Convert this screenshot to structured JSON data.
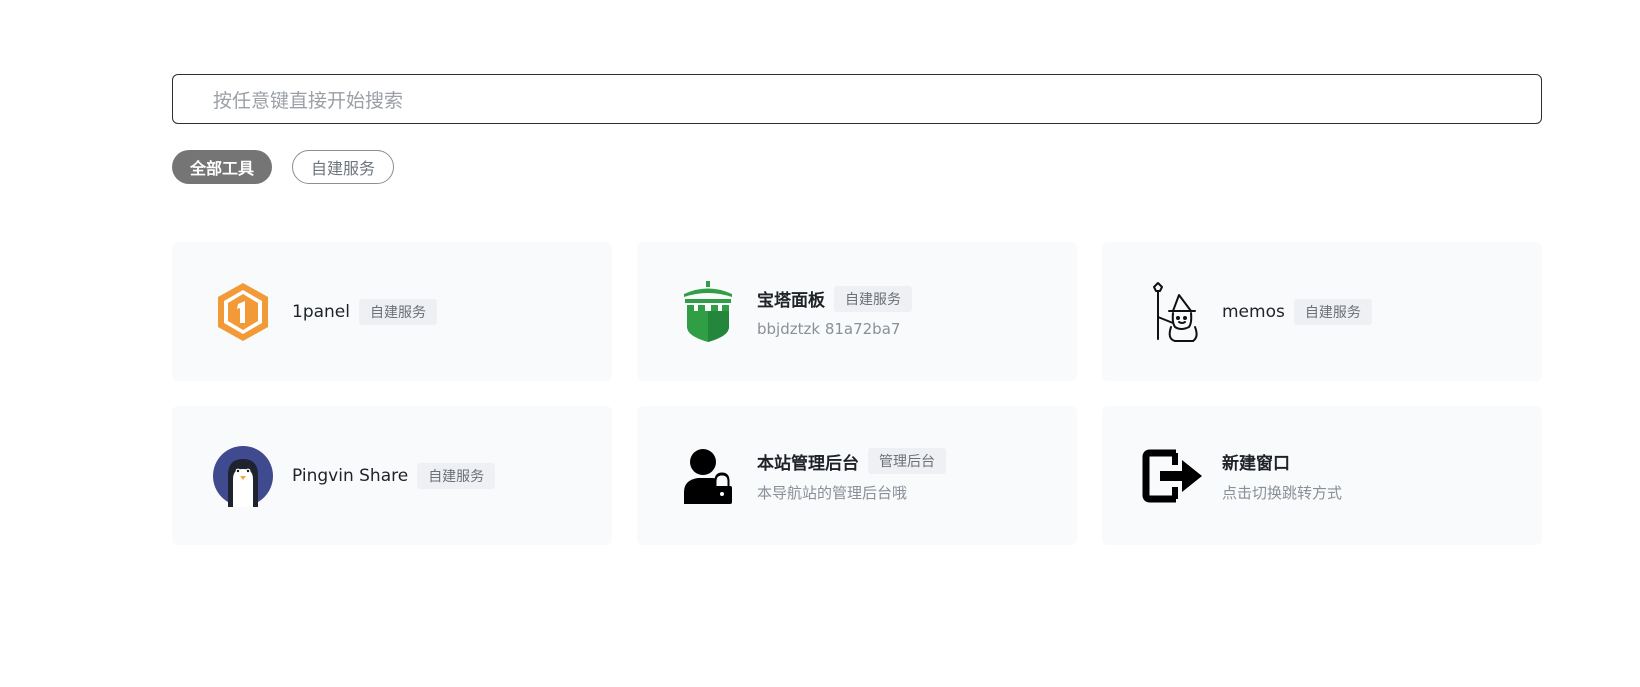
{
  "search": {
    "placeholder": "按任意键直接开始搜索"
  },
  "tabs": [
    {
      "label": "全部工具",
      "active": true
    },
    {
      "label": "自建服务",
      "active": false
    }
  ],
  "cards": [
    {
      "title": "1panel",
      "tag": "自建服务",
      "desc": "",
      "icon": "1panel-hexagon-icon"
    },
    {
      "title": "宝塔面板",
      "tag": "自建服务",
      "desc": "bbjdztzk 81a72ba7",
      "icon": "baota-castle-icon"
    },
    {
      "title": "memos",
      "tag": "自建服务",
      "desc": "",
      "icon": "memos-wizard-icon"
    },
    {
      "title": "Pingvin Share",
      "tag": "自建服务",
      "desc": "",
      "icon": "penguin-icon"
    },
    {
      "title": "本站管理后台",
      "tag": "管理后台",
      "desc": "本导航站的管理后台哦",
      "icon": "admin-user-lock-icon"
    },
    {
      "title": "新建窗口",
      "tag": "",
      "desc": "点击切换跳转方式",
      "icon": "exit-window-icon"
    }
  ],
  "colors": {
    "active_tab_bg": "#757575",
    "card_bg": "#f8fafc",
    "panel_orange": "#f29a38",
    "baota_green": "#2f9e44",
    "pingvin_blue": "#3f4a8f"
  }
}
